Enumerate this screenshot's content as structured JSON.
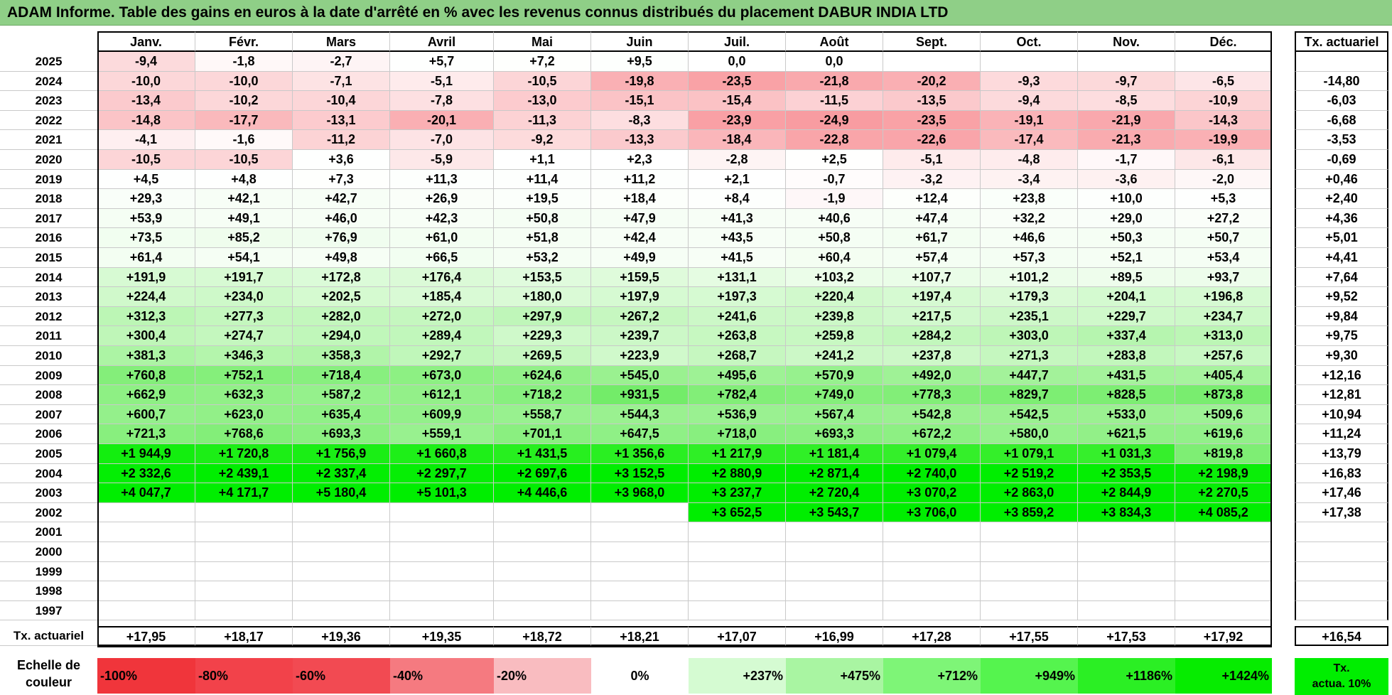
{
  "title": "ADAM Informe. Table des gains en euros à la date d'arrêté en % avec les revenus connus distribués du placement DABUR INDIA LTD",
  "months": [
    "Janv.",
    "Févr.",
    "Mars",
    "Avril",
    "Mai",
    "Juin",
    "Juil.",
    "Août",
    "Sept.",
    "Oct.",
    "Nov.",
    "Déc."
  ],
  "tx_header": "Tx. actuariel",
  "rows": [
    {
      "year": "2025",
      "values": [
        "-9,4",
        "-1,8",
        "-2,7",
        "+5,7",
        "+7,2",
        "+9,5",
        "0,0",
        "0,0",
        "",
        "",
        "",
        ""
      ],
      "tx": ""
    },
    {
      "year": "2024",
      "values": [
        "-10,0",
        "-10,0",
        "-7,1",
        "-5,1",
        "-10,5",
        "-19,8",
        "-23,5",
        "-21,8",
        "-20,2",
        "-9,3",
        "-9,7",
        "-6,5"
      ],
      "tx": "-14,80"
    },
    {
      "year": "2023",
      "values": [
        "-13,4",
        "-10,2",
        "-10,4",
        "-7,8",
        "-13,0",
        "-15,1",
        "-15,4",
        "-11,5",
        "-13,5",
        "-9,4",
        "-8,5",
        "-10,9"
      ],
      "tx": "-6,03"
    },
    {
      "year": "2022",
      "values": [
        "-14,8",
        "-17,7",
        "-13,1",
        "-20,1",
        "-11,3",
        "-8,3",
        "-23,9",
        "-24,9",
        "-23,5",
        "-19,1",
        "-21,9",
        "-14,3"
      ],
      "tx": "-6,68"
    },
    {
      "year": "2021",
      "values": [
        "-4,1",
        "-1,6",
        "-11,2",
        "-7,0",
        "-9,2",
        "-13,3",
        "-18,4",
        "-22,8",
        "-22,6",
        "-17,4",
        "-21,3",
        "-19,9"
      ],
      "tx": "-3,53"
    },
    {
      "year": "2020",
      "values": [
        "-10,5",
        "-10,5",
        "+3,6",
        "-5,9",
        "+1,1",
        "+2,3",
        "-2,8",
        "+2,5",
        "-5,1",
        "-4,8",
        "-1,7",
        "-6,1"
      ],
      "tx": "-0,69"
    },
    {
      "year": "2019",
      "values": [
        "+4,5",
        "+4,8",
        "+7,3",
        "+11,3",
        "+11,4",
        "+11,2",
        "+2,1",
        "-0,7",
        "-3,2",
        "-3,4",
        "-3,6",
        "-2,0"
      ],
      "tx": "+0,46"
    },
    {
      "year": "2018",
      "values": [
        "+29,3",
        "+42,1",
        "+42,7",
        "+26,9",
        "+19,5",
        "+18,4",
        "+8,4",
        "-1,9",
        "+12,4",
        "+23,8",
        "+10,0",
        "+5,3"
      ],
      "tx": "+2,40"
    },
    {
      "year": "2017",
      "values": [
        "+53,9",
        "+49,1",
        "+46,0",
        "+42,3",
        "+50,8",
        "+47,9",
        "+41,3",
        "+40,6",
        "+47,4",
        "+32,2",
        "+29,0",
        "+27,2"
      ],
      "tx": "+4,36"
    },
    {
      "year": "2016",
      "values": [
        "+73,5",
        "+85,2",
        "+76,9",
        "+61,0",
        "+51,8",
        "+42,4",
        "+43,5",
        "+50,8",
        "+61,7",
        "+46,6",
        "+50,3",
        "+50,7"
      ],
      "tx": "+5,01"
    },
    {
      "year": "2015",
      "values": [
        "+61,4",
        "+54,1",
        "+49,8",
        "+66,5",
        "+53,2",
        "+49,9",
        "+41,5",
        "+60,4",
        "+57,4",
        "+57,3",
        "+52,1",
        "+53,4"
      ],
      "tx": "+4,41"
    },
    {
      "year": "2014",
      "values": [
        "+191,9",
        "+191,7",
        "+172,8",
        "+176,4",
        "+153,5",
        "+159,5",
        "+131,1",
        "+103,2",
        "+107,7",
        "+101,2",
        "+89,5",
        "+93,7"
      ],
      "tx": "+7,64"
    },
    {
      "year": "2013",
      "values": [
        "+224,4",
        "+234,0",
        "+202,5",
        "+185,4",
        "+180,0",
        "+197,9",
        "+197,3",
        "+220,4",
        "+197,4",
        "+179,3",
        "+204,1",
        "+196,8"
      ],
      "tx": "+9,52"
    },
    {
      "year": "2012",
      "values": [
        "+312,3",
        "+277,3",
        "+282,0",
        "+272,0",
        "+297,9",
        "+267,2",
        "+241,6",
        "+239,8",
        "+217,5",
        "+235,1",
        "+229,7",
        "+234,7"
      ],
      "tx": "+9,84"
    },
    {
      "year": "2011",
      "values": [
        "+300,4",
        "+274,7",
        "+294,0",
        "+289,4",
        "+229,3",
        "+239,7",
        "+263,8",
        "+259,8",
        "+284,2",
        "+303,0",
        "+337,4",
        "+313,0"
      ],
      "tx": "+9,75"
    },
    {
      "year": "2010",
      "values": [
        "+381,3",
        "+346,3",
        "+358,3",
        "+292,7",
        "+269,5",
        "+223,9",
        "+268,7",
        "+241,2",
        "+237,8",
        "+271,3",
        "+283,8",
        "+257,6"
      ],
      "tx": "+9,30"
    },
    {
      "year": "2009",
      "values": [
        "+760,8",
        "+752,1",
        "+718,4",
        "+673,0",
        "+624,6",
        "+545,0",
        "+495,6",
        "+570,9",
        "+492,0",
        "+447,7",
        "+431,5",
        "+405,4"
      ],
      "tx": "+12,16"
    },
    {
      "year": "2008",
      "values": [
        "+662,9",
        "+632,3",
        "+587,2",
        "+612,1",
        "+718,2",
        "+931,5",
        "+782,4",
        "+749,0",
        "+778,3",
        "+829,7",
        "+828,5",
        "+873,8"
      ],
      "tx": "+12,81"
    },
    {
      "year": "2007",
      "values": [
        "+600,7",
        "+623,0",
        "+635,4",
        "+609,9",
        "+558,7",
        "+544,3",
        "+536,9",
        "+567,4",
        "+542,8",
        "+542,5",
        "+533,0",
        "+509,6"
      ],
      "tx": "+10,94"
    },
    {
      "year": "2006",
      "values": [
        "+721,3",
        "+768,6",
        "+693,3",
        "+559,1",
        "+701,1",
        "+647,5",
        "+718,0",
        "+693,3",
        "+672,2",
        "+580,0",
        "+621,5",
        "+619,6"
      ],
      "tx": "+11,24"
    },
    {
      "year": "2005",
      "values": [
        "+1 944,9",
        "+1 720,8",
        "+1 756,9",
        "+1 660,8",
        "+1 431,5",
        "+1 356,6",
        "+1 217,9",
        "+1 181,4",
        "+1 079,4",
        "+1 079,1",
        "+1 031,3",
        "+819,8"
      ],
      "tx": "+13,79"
    },
    {
      "year": "2004",
      "values": [
        "+2 332,6",
        "+2 439,1",
        "+2 337,4",
        "+2 297,7",
        "+2 697,6",
        "+3 152,5",
        "+2 880,9",
        "+2 871,4",
        "+2 740,0",
        "+2 519,2",
        "+2 353,5",
        "+2 198,9"
      ],
      "tx": "+16,83"
    },
    {
      "year": "2003",
      "values": [
        "+4 047,7",
        "+4 171,7",
        "+5 180,4",
        "+5 101,3",
        "+4 446,6",
        "+3 968,0",
        "+3 237,7",
        "+2 720,4",
        "+3 070,2",
        "+2 863,0",
        "+2 844,9",
        "+2 270,5"
      ],
      "tx": "+17,46"
    },
    {
      "year": "2002",
      "values": [
        "",
        "",
        "",
        "",
        "",
        "",
        "+3 652,5",
        "+3 543,7",
        "+3 706,0",
        "+3 859,2",
        "+3 834,3",
        "+4 085,2"
      ],
      "tx": "+17,38"
    },
    {
      "year": "2001",
      "values": [
        "",
        "",
        "",
        "",
        "",
        "",
        "",
        "",
        "",
        "",
        "",
        ""
      ],
      "tx": ""
    },
    {
      "year": "2000",
      "values": [
        "",
        "",
        "",
        "",
        "",
        "",
        "",
        "",
        "",
        "",
        "",
        ""
      ],
      "tx": ""
    },
    {
      "year": "1999",
      "values": [
        "",
        "",
        "",
        "",
        "",
        "",
        "",
        "",
        "",
        "",
        "",
        ""
      ],
      "tx": ""
    },
    {
      "year": "1998",
      "values": [
        "",
        "",
        "",
        "",
        "",
        "",
        "",
        "",
        "",
        "",
        "",
        ""
      ],
      "tx": ""
    },
    {
      "year": "1997",
      "values": [
        "",
        "",
        "",
        "",
        "",
        "",
        "",
        "",
        "",
        "",
        "",
        ""
      ],
      "tx": ""
    }
  ],
  "footer": {
    "label": "Tx. actuariel",
    "values": [
      "+17,95",
      "+18,17",
      "+19,36",
      "+19,35",
      "+18,72",
      "+18,21",
      "+17,07",
      "+16,99",
      "+17,28",
      "+17,55",
      "+17,53",
      "+17,92"
    ],
    "tx": "+16,54"
  },
  "scale": {
    "label_line1": "Echelle de",
    "label_line2": "couleur",
    "items": [
      {
        "label": "-100%",
        "color": "#f0353b",
        "kind": "neg"
      },
      {
        "label": "-80%",
        "color": "#f2424a",
        "kind": "neg"
      },
      {
        "label": "-60%",
        "color": "#f24a52",
        "kind": "neg"
      },
      {
        "label": "-40%",
        "color": "#f57a80",
        "kind": "neg"
      },
      {
        "label": "-20%",
        "color": "#f9bcc0",
        "kind": "neg"
      },
      {
        "label": "0%",
        "color": "#ffffff",
        "kind": "zero"
      },
      {
        "label": "+237%",
        "color": "#d5fbd2",
        "kind": "pos"
      },
      {
        "label": "+475%",
        "color": "#a9f5a2",
        "kind": "pos"
      },
      {
        "label": "+712%",
        "color": "#7ef577",
        "kind": "pos"
      },
      {
        "label": "+949%",
        "color": "#55f44e",
        "kind": "pos"
      },
      {
        "label": "+1186%",
        "color": "#2bef24",
        "kind": "pos"
      },
      {
        "label": "+1424%",
        "color": "#06ec00",
        "kind": "pos"
      }
    ],
    "tx_line1": "Tx.",
    "tx_line2": "actua. 10%"
  }
}
